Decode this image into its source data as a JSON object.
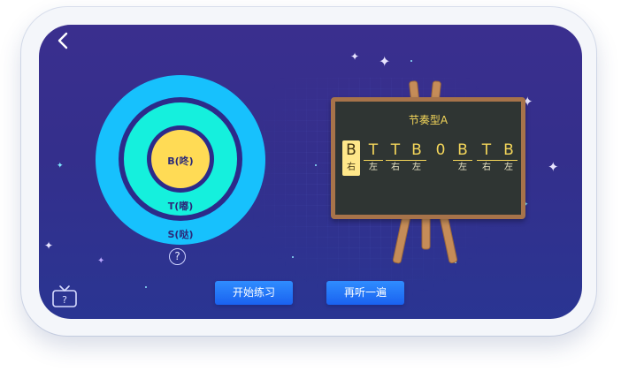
{
  "target": {
    "inner_label": "B(咚)",
    "middle_label": "T(嘟)",
    "outer_label": "S(哒)",
    "help_symbol": "?",
    "colors": {
      "outer": "#17c1fd",
      "middle": "#15f0dd",
      "inner": "#ffdb55"
    }
  },
  "board": {
    "title": "节奏型A",
    "beats": [
      {
        "note": "B",
        "hand": "右"
      },
      {
        "note": "T",
        "hand": "左"
      },
      {
        "note": "T",
        "hand": "右"
      },
      {
        "note": "B",
        "hand": "左"
      },
      {
        "note": "0",
        "hand": ""
      },
      {
        "note": "B",
        "hand": "左"
      },
      {
        "note": "T",
        "hand": "右"
      },
      {
        "note": "B",
        "hand": "左"
      }
    ],
    "highlighted_index": 0
  },
  "buttons": {
    "start": "开始练习",
    "listen_again": "再听一遍"
  },
  "icons": {
    "back": "back-chevron-icon",
    "help": "help-circle-icon",
    "tv": "tv-help-icon"
  }
}
